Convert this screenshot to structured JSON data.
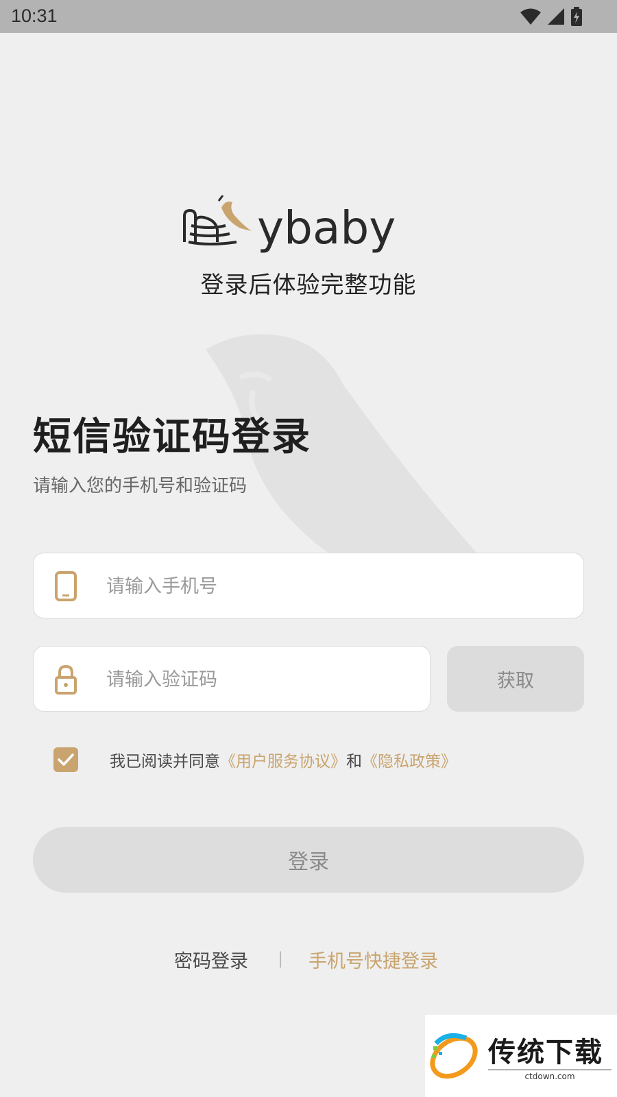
{
  "status_bar": {
    "time": "10:31"
  },
  "brand": {
    "logo_text": "ybaby",
    "tagline": "登录后体验完整功能"
  },
  "login": {
    "title": "短信验证码登录",
    "subtitle": "请输入您的手机号和验证码",
    "phone_placeholder": "请输入手机号",
    "code_placeholder": "请输入验证码",
    "get_code_label": "获取",
    "agreement": {
      "checked": true,
      "prefix": "我已阅读并同意",
      "terms_link": "《用户服务协议》",
      "and": "和",
      "privacy_link": "《隐私政策》"
    },
    "submit_label": "登录",
    "password_login_label": "密码登录",
    "separator": "|",
    "quick_login_label": "手机号快捷登录"
  },
  "watermark_badge": {
    "title": "传统下载",
    "subtitle": "ctdown.com"
  },
  "colors": {
    "accent": "#c9a46e",
    "background": "#efefef",
    "status_bar": "#b3b3b3"
  }
}
